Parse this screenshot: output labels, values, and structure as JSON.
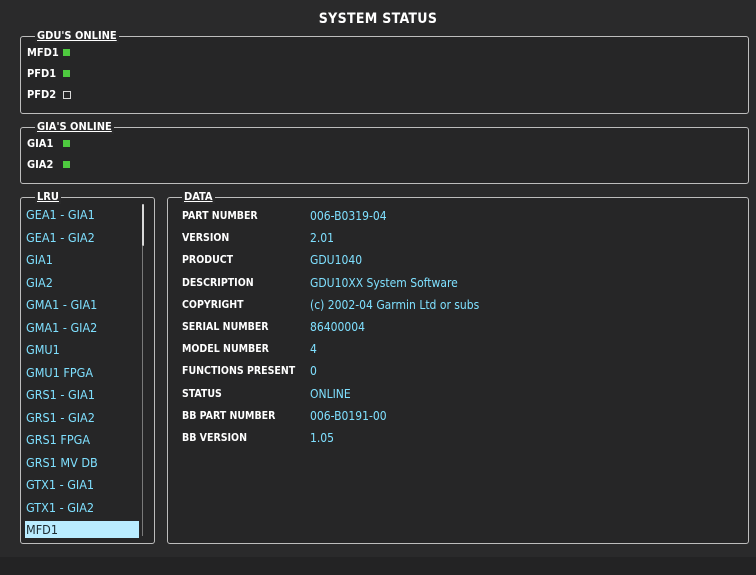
{
  "title": "SYSTEM STATUS",
  "colors": {
    "online": "#4ec93f",
    "accent_cyan": "#7fe0ff",
    "selected_bg": "#b9ecff"
  },
  "gdus": {
    "legend": "GDU'S ONLINE",
    "items": [
      {
        "name": "MFD1",
        "online": true
      },
      {
        "name": "PFD1",
        "online": true
      },
      {
        "name": "PFD2",
        "online": false
      }
    ]
  },
  "gias": {
    "legend": "GIA'S ONLINE",
    "items": [
      {
        "name": "GIA1",
        "online": true
      },
      {
        "name": "GIA2",
        "online": true
      }
    ]
  },
  "lru": {
    "legend": "LRU",
    "items": [
      "GEA1 - GIA1",
      "GEA1 - GIA2",
      "GIA1",
      "GIA2",
      "GMA1 - GIA1",
      "GMA1 - GIA2",
      "GMU1",
      "GMU1 FPGA",
      "GRS1 - GIA1",
      "GRS1 - GIA2",
      "GRS1 FPGA",
      "GRS1 MV DB",
      "GTX1 - GIA1",
      "GTX1 - GIA2",
      "MFD1"
    ],
    "selected_index": 14
  },
  "data": {
    "legend": "DATA",
    "rows": [
      {
        "label": "PART NUMBER",
        "value": "006-B0319-04"
      },
      {
        "label": "VERSION",
        "value": "2.01"
      },
      {
        "label": "PRODUCT",
        "value": "GDU1040"
      },
      {
        "label": "DESCRIPTION",
        "value": "GDU10XX System Software"
      },
      {
        "label": "COPYRIGHT",
        "value": "(c) 2002-04 Garmin Ltd or subs"
      },
      {
        "label": "SERIAL NUMBER",
        "value": "86400004"
      },
      {
        "label": "MODEL NUMBER",
        "value": "4"
      },
      {
        "label": "FUNCTIONS PRESENT",
        "value": "0"
      },
      {
        "label": "STATUS",
        "value": "ONLINE"
      },
      {
        "label": "BB PART NUMBER",
        "value": "006-B0191-00"
      },
      {
        "label": "BB VERSION",
        "value": "1.05"
      }
    ]
  }
}
